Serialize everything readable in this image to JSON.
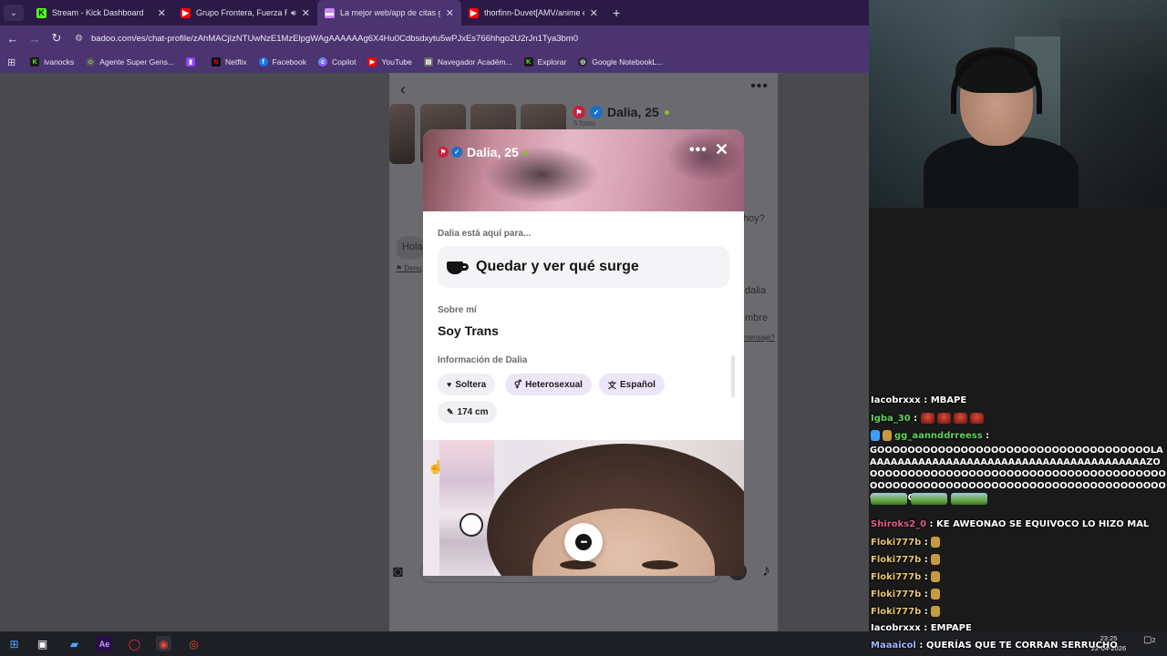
{
  "browser": {
    "tabs": [
      {
        "title": "Stream - Kick Dashboard",
        "icon": "kick-icon",
        "color": "#53fc18"
      },
      {
        "title": "Grupo Frontera, Fuerza Reg",
        "icon": "youtube-icon",
        "color": "#ff0000"
      },
      {
        "title": "La mejor web/app de citas grat",
        "icon": "badoo-icon",
        "color": "#c987f5"
      },
      {
        "title": "thorfinn-Duvet[AMV/anime ed",
        "icon": "youtube-icon",
        "color": "#ff0000"
      }
    ],
    "active_tab": 2,
    "url": "badoo.com/es/chat-profile/zAhMACjIzNTUwNzE1MzElpgWAgAAAAAAg6X4Hu0Cdbsdxytu5wPJxEs766hhgo2U2rJn1Tya3bm0",
    "bookmarks": [
      {
        "label": "ivanocks",
        "icon": "kick-icon"
      },
      {
        "label": "Agente Super Gens...",
        "icon": "agent-icon"
      },
      {
        "label": "",
        "icon": "twitch-icon"
      },
      {
        "label": "Netflix",
        "icon": "netflix-icon"
      },
      {
        "label": "Facebook",
        "icon": "facebook-icon"
      },
      {
        "label": "Copilot",
        "icon": "copilot-icon"
      },
      {
        "label": "YouTube",
        "icon": "youtube-icon"
      },
      {
        "label": "Navegador Académ...",
        "icon": "bookmark-icon"
      },
      {
        "label": "Explorar",
        "icon": "kick-icon"
      },
      {
        "label": "Google NotebookL...",
        "icon": "notebooklm-icon"
      }
    ]
  },
  "chat_page": {
    "profile_name": "Dalia, 25",
    "photo_count": "5 fotos",
    "peek_texts": {
      "hola": "Hola",
      "denunciar": "Denu",
      "hoy": "hoy?",
      "dalia": "dalia",
      "nombre": "mbre",
      "mensaje": "mensaje?"
    }
  },
  "profile_modal": {
    "name": "Dalia, 25",
    "here_for_label": "Dalia está aquí para...",
    "intent": "Quedar y ver qué surge",
    "about_label": "Sobre mí",
    "about_text": "Soy Trans",
    "info_label": "Información de Dalia",
    "chips": [
      {
        "label": "Soltera",
        "icon": "heart-icon"
      },
      {
        "label": "Heterosexual",
        "icon": "orientation-icon"
      },
      {
        "label": "Español",
        "icon": "language-icon"
      },
      {
        "label": "174 cm",
        "icon": "ruler-icon"
      }
    ]
  },
  "stream_chat": [
    {
      "user": "Iacobrxxx",
      "user_color": "#ffffff",
      "text": "MBAPE"
    },
    {
      "user": "Igba_30",
      "user_color": "#5fd35f",
      "text": ""
    },
    {
      "user": "gg_aannddrreess",
      "user_color": "#5fd35f",
      "text": ""
    },
    {
      "text": "GOOOOOOOOOOOOOOOOOOOOOOOOOOOOOOOOOOOOLAAAAAAAAAAAAAAAAAAAAAAAAAAAAAAAAAAAAAAAAAZOOOOOOOOOOOOOOOOOOOOOOOOOOOOOOOOOOOOOOOOOOOOOOOOOOOOOOOOOOOOOOOOOOOOOOOOOOOOOOOOOOOOOO"
    },
    {
      "user": "Shiroks2_0",
      "user_color": "#e05a8a",
      "text": "KE AWEONAO SE EQUIVOCO LO HIZO MAL"
    },
    {
      "user": "Floki777b",
      "user_color": "#e8c66b",
      "text": ""
    },
    {
      "user": "Floki777b",
      "user_color": "#e8c66b",
      "text": ""
    },
    {
      "user": "Floki777b",
      "user_color": "#e8c66b",
      "text": ""
    },
    {
      "user": "Floki777b",
      "user_color": "#e8c66b",
      "text": ""
    },
    {
      "user": "Floki777b",
      "user_color": "#e8c66b",
      "text": ""
    },
    {
      "user": "Iacobrxxx",
      "user_color": "#ffffff",
      "text": "EMPAPE"
    },
    {
      "user": "Maaaicol",
      "user_color": "#9fb4ff",
      "text": "QUERÍAS QUE TE CORRAN SERRUCHO"
    }
  ],
  "taskbar": {
    "time": "23:25",
    "date": "22-04-2026",
    "notifications": "2"
  }
}
